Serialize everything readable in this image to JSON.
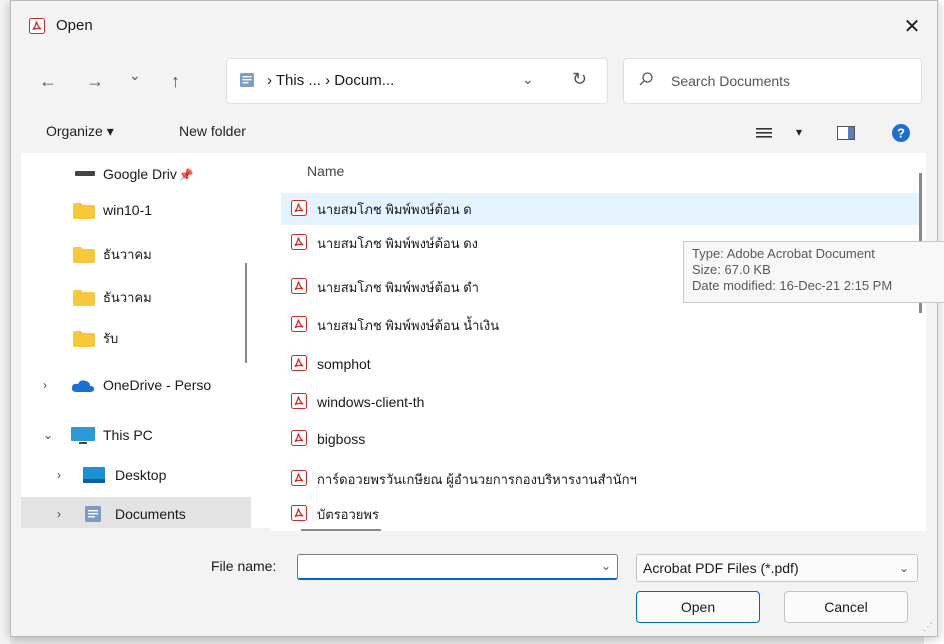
{
  "window": {
    "title": "Open",
    "close_glyph": "✕"
  },
  "nav": {
    "back": "←",
    "forward": "→",
    "recent": "⌄",
    "up": "↑",
    "breadcrumb": "›  This ...  ›  Docum...",
    "dropdown": "⌄",
    "refresh": "↻",
    "search_placeholder": "Search Documents"
  },
  "toolbar": {
    "organize": "Organize ▾",
    "new_folder": "New folder",
    "view_menu": "▾"
  },
  "sidebar": {
    "items": [
      {
        "label": "Google Driv",
        "icon": "drive-icon"
      },
      {
        "label": "win10-1",
        "icon": "folder-icon"
      },
      {
        "label": "ธันวาคม",
        "icon": "folder-icon"
      },
      {
        "label": "ธันวาคม",
        "icon": "folder-icon"
      },
      {
        "label": "รับ",
        "icon": "folder-icon"
      },
      {
        "label": "OneDrive - Perso",
        "icon": "cloud-icon"
      },
      {
        "label": "This PC",
        "icon": "computer-icon"
      },
      {
        "label": "Desktop",
        "icon": "desktop-icon"
      },
      {
        "label": "Documents",
        "icon": "documents-icon"
      }
    ],
    "chevron_right": "›",
    "chevron_down": "⌄",
    "pin": "📌"
  },
  "files": {
    "column_name": "Name",
    "rows": [
      "นายสมโภช พิมพ์พงษ์ต้อน ด",
      "นายสมโภช พิมพ์พงษ์ต้อน ดง",
      "นายสมโภช พิมพ์พงษ์ต้อน ดำ",
      "นายสมโภช พิมพ์พงษ์ต้อน น้ำเงิน",
      "somphot",
      "windows-client-th",
      "bigboss",
      "การ์ดอวยพรวันเกษียณ ผู้อำนวยการกองบริหารงานสำนักฯ",
      "บัตรอวยพร"
    ]
  },
  "tooltip": {
    "type": "Type: Adobe Acrobat Document",
    "size": "Size: 67.0 KB",
    "date": "Date modified: 16-Dec-21 2:15 PM"
  },
  "bottom": {
    "file_name_label": "File name:",
    "file_name_value": "",
    "file_type": "Acrobat PDF Files (*.pdf)",
    "dropdown": "⌄",
    "open": "Open",
    "cancel": "Cancel",
    "grip": "⋰"
  },
  "colors": {
    "accent": "#0067c0",
    "pdf_red": "#d42a2a",
    "folder": "#f8c83c",
    "hover": "#e5f3ff"
  }
}
